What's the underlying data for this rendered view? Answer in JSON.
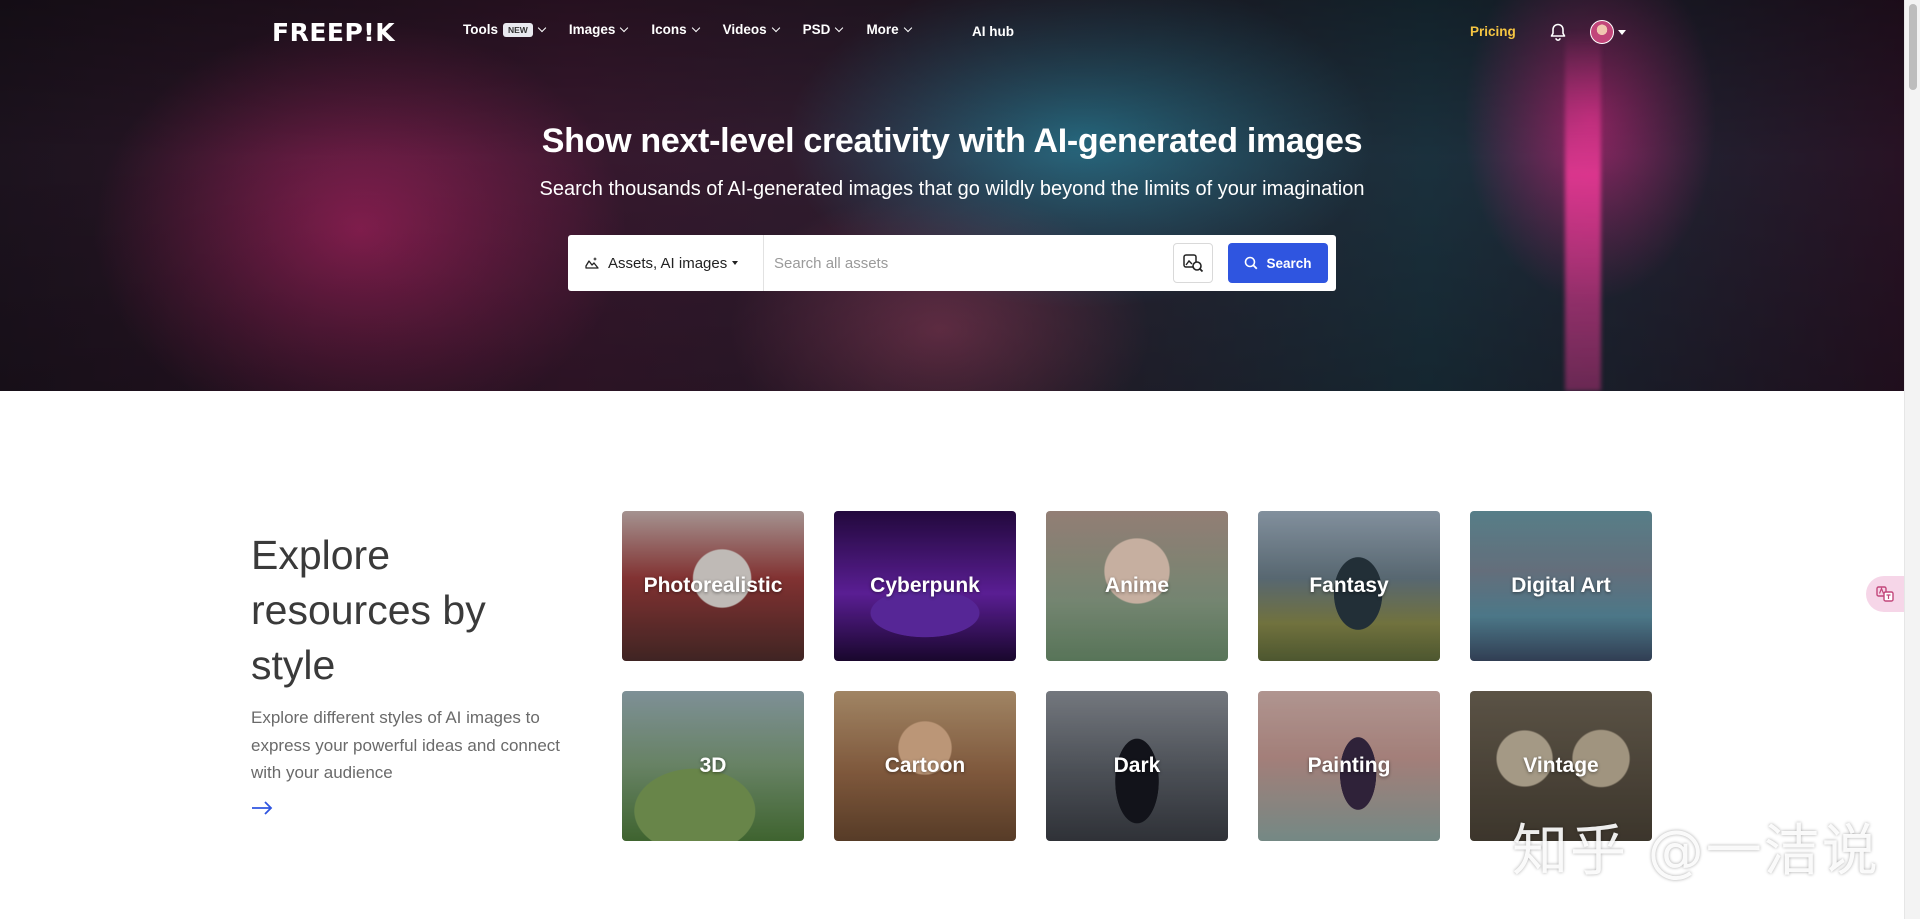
{
  "brand": {
    "logo_text": "FREEP!K"
  },
  "nav": {
    "items": [
      {
        "label": "Tools",
        "badge": "NEW"
      },
      {
        "label": "Images"
      },
      {
        "label": "Icons"
      },
      {
        "label": "Videos"
      },
      {
        "label": "PSD"
      },
      {
        "label": "More"
      }
    ],
    "ai_hub": "AI hub",
    "pricing": "Pricing"
  },
  "hero": {
    "title": "Show next-level creativity with AI-generated images",
    "subtitle": "Search thousands of AI-generated images that go wildly beyond the limits of your imagination"
  },
  "search": {
    "type_label": "Assets, AI images",
    "placeholder": "Search all assets",
    "button_label": "Search"
  },
  "explore": {
    "heading": "Explore resources by style",
    "description": "Explore different styles of AI images to express your powerful ideas and connect with your audience",
    "styles": [
      "Photorealistic",
      "Cyberpunk",
      "Anime",
      "Fantasy",
      "Digital Art",
      "3D",
      "Cartoon",
      "Dark",
      "Painting",
      "Vintage"
    ]
  },
  "watermark": {
    "corner_text": "知乎 @一洁说"
  },
  "colors": {
    "accent": "#2f55e0",
    "pricing": "#f5c542"
  }
}
